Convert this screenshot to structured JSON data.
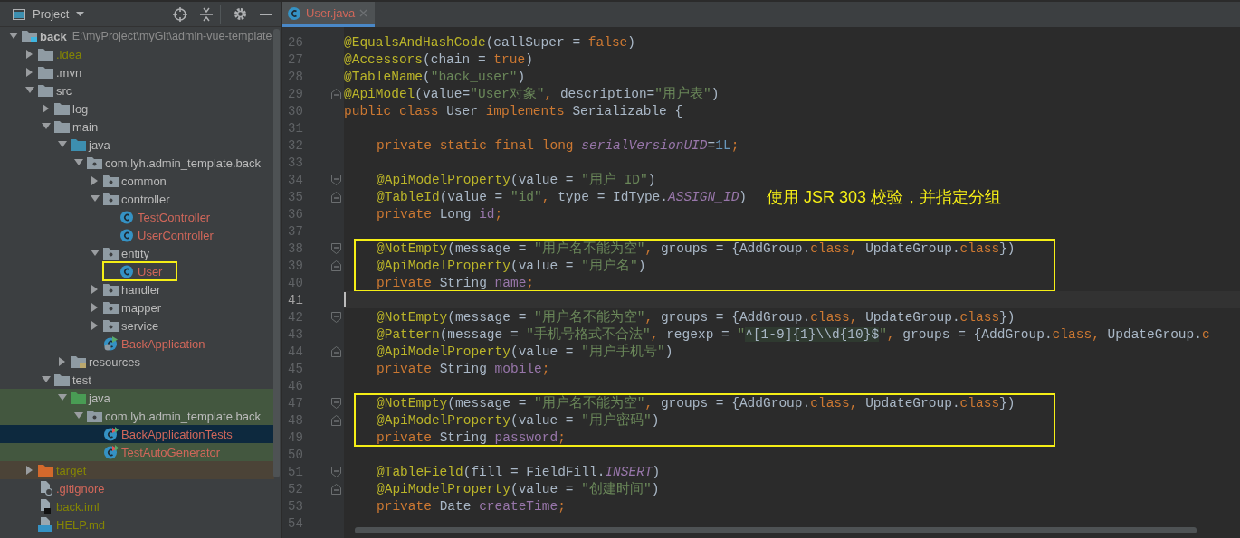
{
  "project": {
    "title": "Project",
    "tree": [
      {
        "label": "back",
        "path": "E:\\myProject\\myGit\\admin-vue-template",
        "kind": "module",
        "expanded": true,
        "selected": false,
        "children": [
          {
            "label": ".idea",
            "kind": "folder",
            "expanded": false,
            "ignored": true,
            "selected": false
          },
          {
            "label": ".mvn",
            "kind": "folder",
            "expanded": false,
            "selected": false
          },
          {
            "label": "src",
            "kind": "folder",
            "expanded": true,
            "selected": false,
            "children": [
              {
                "label": "log",
                "kind": "folder",
                "expanded": false,
                "selected": false
              },
              {
                "label": "main",
                "kind": "folder",
                "expanded": true,
                "selected": false,
                "children": [
                  {
                    "label": "java",
                    "kind": "sources",
                    "expanded": true,
                    "selected": false,
                    "children": [
                      {
                        "label": "com.lyh.admin_template.back",
                        "kind": "package",
                        "expanded": true,
                        "selected": false,
                        "children": [
                          {
                            "label": "common",
                            "kind": "package",
                            "expanded": false,
                            "selected": false
                          },
                          {
                            "label": "controller",
                            "kind": "package",
                            "expanded": true,
                            "selected": false,
                            "children": [
                              {
                                "label": "TestController",
                                "kind": "class",
                                "untracked": true,
                                "selected": false
                              },
                              {
                                "label": "UserController",
                                "kind": "class",
                                "untracked": true,
                                "selected": false
                              }
                            ]
                          },
                          {
                            "label": "entity",
                            "kind": "package",
                            "expanded": true,
                            "selected": false,
                            "children": [
                              {
                                "label": "User",
                                "kind": "class",
                                "untracked": true,
                                "boxed": true,
                                "selected": false
                              }
                            ]
                          },
                          {
                            "label": "handler",
                            "kind": "package",
                            "expanded": false,
                            "selected": false
                          },
                          {
                            "label": "mapper",
                            "kind": "package",
                            "expanded": false,
                            "selected": false
                          },
                          {
                            "label": "service",
                            "kind": "package",
                            "expanded": false,
                            "selected": false
                          },
                          {
                            "label": "BackApplication",
                            "kind": "application",
                            "untracked": true,
                            "selected": false
                          }
                        ]
                      }
                    ]
                  },
                  {
                    "label": "resources",
                    "kind": "resources",
                    "expanded": false,
                    "selected": false
                  }
                ]
              },
              {
                "label": "test",
                "kind": "folder",
                "expanded": true,
                "selected": false,
                "children": [
                  {
                    "label": "java",
                    "kind": "tests",
                    "expanded": true,
                    "test_scope": true,
                    "selected": false,
                    "children": [
                      {
                        "label": "com.lyh.admin_template.back",
                        "kind": "package",
                        "expanded": true,
                        "test_scope": true,
                        "selected": false,
                        "children": [
                          {
                            "label": "BackApplicationTests",
                            "kind": "testclass",
                            "untracked": true,
                            "test_scope": true,
                            "selected": true
                          },
                          {
                            "label": "TestAutoGenerator",
                            "kind": "testclass",
                            "untracked": true,
                            "test_scope": true,
                            "selected": false
                          }
                        ]
                      }
                    ]
                  }
                ]
              }
            ]
          },
          {
            "label": "target",
            "kind": "excluded",
            "expanded": false,
            "ignored": true,
            "excluded_scope": true,
            "selected": false
          },
          {
            "label": ".gitignore",
            "kind": "gitignore",
            "untracked": true,
            "selected": false
          },
          {
            "label": "back.iml",
            "kind": "iml",
            "ignored": true,
            "selected": false
          },
          {
            "label": "HELP.md",
            "kind": "markdown",
            "ignored": true,
            "selected": false
          }
        ]
      }
    ]
  },
  "editor": {
    "tabs": [
      {
        "label": "User.java",
        "untracked": true,
        "selected": true
      }
    ],
    "blocks": [
      {
        "boxed": false,
        "lines": [
          {
            "number": "26",
            "text": "@EqualsAndHashCode(callSuper = false)"
          },
          {
            "number": "27",
            "text": "@Accessors(chain = true)"
          },
          {
            "number": "28",
            "text": "@TableName(\"back_user\")"
          },
          {
            "number": "29",
            "fold_end": true,
            "text": "@ApiModel(value=\"User对象\", description=\"用户表\")"
          },
          {
            "number": "30",
            "text": "public class User implements Serializable {"
          },
          {
            "number": "31"
          },
          {
            "number": "32",
            "indented": true,
            "text": "private static final long serialVersionUID=1L;"
          },
          {
            "number": "33"
          },
          {
            "number": "34",
            "indented": true,
            "fold_start": true,
            "text": "@ApiModelProperty(value = \"用户 ID\")"
          },
          {
            "number": "35",
            "indented": true,
            "fold_end": true,
            "text": "@TableId(value = \"id\", type = IdType.ASSIGN_ID)",
            "note": "使用 JSR 303 校验，并指定分组"
          },
          {
            "number": "36",
            "indented": true,
            "text": "private Long id;"
          },
          {
            "number": "37"
          }
        ]
      },
      {
        "boxed": true,
        "lines": [
          {
            "number": "38",
            "indented": true,
            "fold_start": true,
            "text": "@NotEmpty(message = \"用户名不能为空\", groups = {AddGroup.class, UpdateGroup.class})"
          },
          {
            "number": "39",
            "indented": true,
            "fold_end": true,
            "text": "@ApiModelProperty(value = \"用户名\")"
          },
          {
            "number": "40",
            "indented": true,
            "text": "private String name;"
          }
        ]
      },
      {
        "boxed": false,
        "lines": [
          {
            "number": "41",
            "current": true
          },
          {
            "number": "42",
            "indented": true,
            "fold_start": true,
            "text": "@NotEmpty(message = \"用户名不能为空\", groups = {AddGroup.class, UpdateGroup.class})"
          },
          {
            "number": "43",
            "indented": true,
            "text": "@Pattern(message = \"手机号格式不合法\", regexp = \"^[1-9]{1}\\\\d{10}$\", groups = {AddGroup.class, UpdateGroup.c"
          },
          {
            "number": "44",
            "indented": true,
            "fold_end": true,
            "text": "@ApiModelProperty(value = \"用户手机号\")"
          },
          {
            "number": "45",
            "indented": true,
            "text": "private String mobile;"
          },
          {
            "number": "46"
          }
        ]
      },
      {
        "boxed": true,
        "lines": [
          {
            "number": "47",
            "indented": true,
            "fold_start": true,
            "text": "@NotEmpty(message = \"用户名不能为空\", groups = {AddGroup.class, UpdateGroup.class})"
          },
          {
            "number": "48",
            "indented": true,
            "fold_end": true,
            "text": "@ApiModelProperty(value = \"用户密码\")"
          },
          {
            "number": "49",
            "indented": true,
            "text": "private String password;"
          }
        ]
      },
      {
        "boxed": false,
        "lines": [
          {
            "number": "50"
          },
          {
            "number": "51",
            "indented": true,
            "fold_start": true,
            "text": "@TableField(fill = FieldFill.INSERT)"
          },
          {
            "number": "52",
            "indented": true,
            "fold_end": true,
            "text": "@ApiModelProperty(value = \"创建时间\")"
          },
          {
            "number": "53",
            "indented": true,
            "text": "private Date createTime;"
          },
          {
            "number": "54"
          }
        ]
      }
    ]
  }
}
